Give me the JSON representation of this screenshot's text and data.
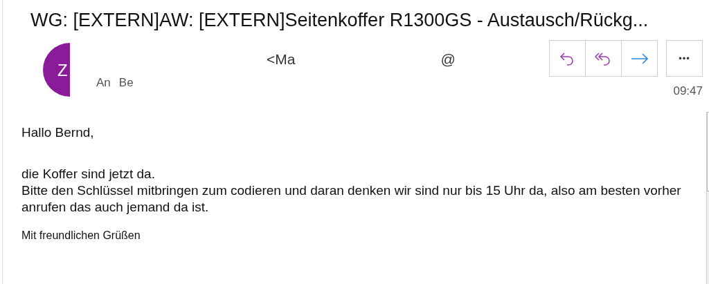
{
  "subject": "WG: [EXTERN]AW: [EXTERN]Seitenkoffer R1300GS - Austausch/Rückg...",
  "sender": {
    "initial": "Z",
    "name": "<Ma",
    "address": "@"
  },
  "recipients": {
    "label": "An",
    "name": "Be"
  },
  "time": "09:47",
  "actions": [
    {
      "kind": "reply"
    },
    {
      "kind": "reply_all"
    },
    {
      "kind": "forward"
    }
  ],
  "more": "•••",
  "body": {
    "greeting": "Hallo Bernd,",
    "lines": [
      "die Koffer sind jetzt da.",
      "Bitte den Schlüssel mitbringen zum codieren und daran denken wir sind nur bis 15 Uhr da, also am besten vorher anrufen das auch jemand da ist."
    ],
    "closing": "Mit freundlichen Grüßen"
  }
}
